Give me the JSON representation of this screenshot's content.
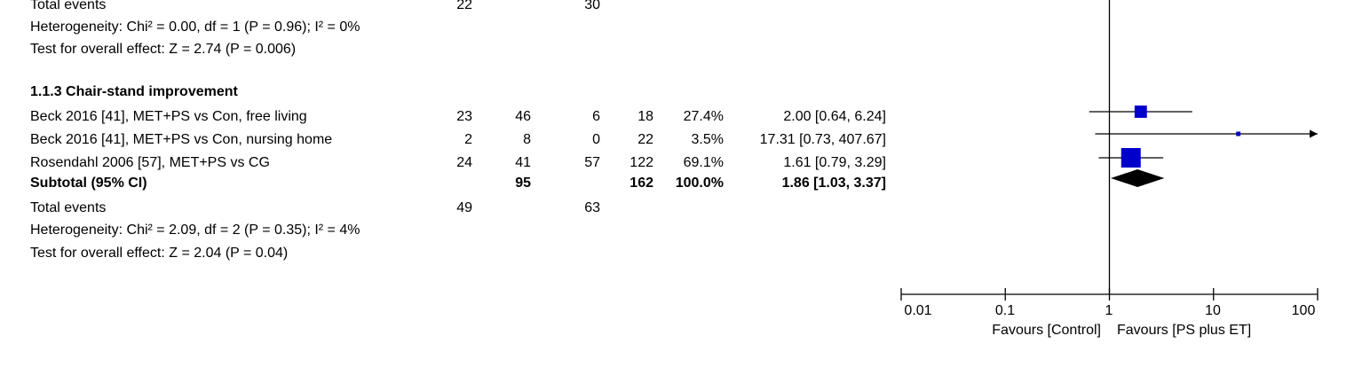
{
  "top_block": {
    "total_events_label": "Total events",
    "total_events_exp": "22",
    "total_events_ctl": "30",
    "heterogeneity": "Heterogeneity: Chi² = 0.00, df = 1 (P = 0.96); I² = 0%",
    "overall_effect": "Test for overall effect: Z = 2.74 (P = 0.006)"
  },
  "section": {
    "heading": "1.1.3 Chair-stand improvement",
    "studies": [
      {
        "name": "Beck 2016 [41], MET+PS vs Con, free living",
        "exp_events": "23",
        "exp_total": "46",
        "ctl_events": "6",
        "ctl_total": "18",
        "weight": "27.4%",
        "ci": "2.00 [0.64, 6.24]"
      },
      {
        "name": "Beck 2016 [41], MET+PS vs Con, nursing home",
        "exp_events": "2",
        "exp_total": "8",
        "ctl_events": "0",
        "ctl_total": "22",
        "weight": "3.5%",
        "ci": "17.31 [0.73, 407.67]"
      },
      {
        "name": "Rosendahl 2006 [57], MET+PS vs CG",
        "exp_events": "24",
        "exp_total": "41",
        "ctl_events": "57",
        "ctl_total": "122",
        "weight": "69.1%",
        "ci": "1.61 [0.79, 3.29]"
      }
    ],
    "subtotal": {
      "label": "Subtotal (95% CI)",
      "exp_total": "95",
      "ctl_total": "162",
      "weight": "100.0%",
      "ci": "1.86 [1.03, 3.37]"
    },
    "total_events_label": "Total events",
    "total_events_exp": "49",
    "total_events_ctl": "63",
    "heterogeneity": "Heterogeneity: Chi² = 2.09, df = 2 (P = 0.35); I² = 4%",
    "overall_effect": "Test for overall effect: Z = 2.04 (P = 0.04)"
  },
  "axis": {
    "ticks": [
      "0.01",
      "0.1",
      "1",
      "10",
      "100"
    ],
    "favours_left": "Favours [Control]",
    "favours_right": "Favours [PS plus ET]"
  },
  "colors": {
    "marker": "#0000cc",
    "diamond": "#000000",
    "line": "#000000"
  },
  "chart_data": {
    "type": "forest",
    "x_scale": "log",
    "xlim": [
      0.01,
      100
    ],
    "reference_line": 1,
    "points": [
      {
        "label": "Beck 2016 [41], MET+PS vs Con, free living",
        "estimate": 2.0,
        "ci_low": 0.64,
        "ci_high": 6.24,
        "weight": 27.4
      },
      {
        "label": "Beck 2016 [41], MET+PS vs Con, nursing home",
        "estimate": 17.31,
        "ci_low": 0.73,
        "ci_high": 407.67,
        "weight": 3.5
      },
      {
        "label": "Rosendahl 2006 [57], MET+PS vs CG",
        "estimate": 1.61,
        "ci_low": 0.79,
        "ci_high": 3.29,
        "weight": 69.1
      }
    ],
    "pooled": {
      "label": "Subtotal (95% CI)",
      "estimate": 1.86,
      "ci_low": 1.03,
      "ci_high": 3.37
    }
  }
}
